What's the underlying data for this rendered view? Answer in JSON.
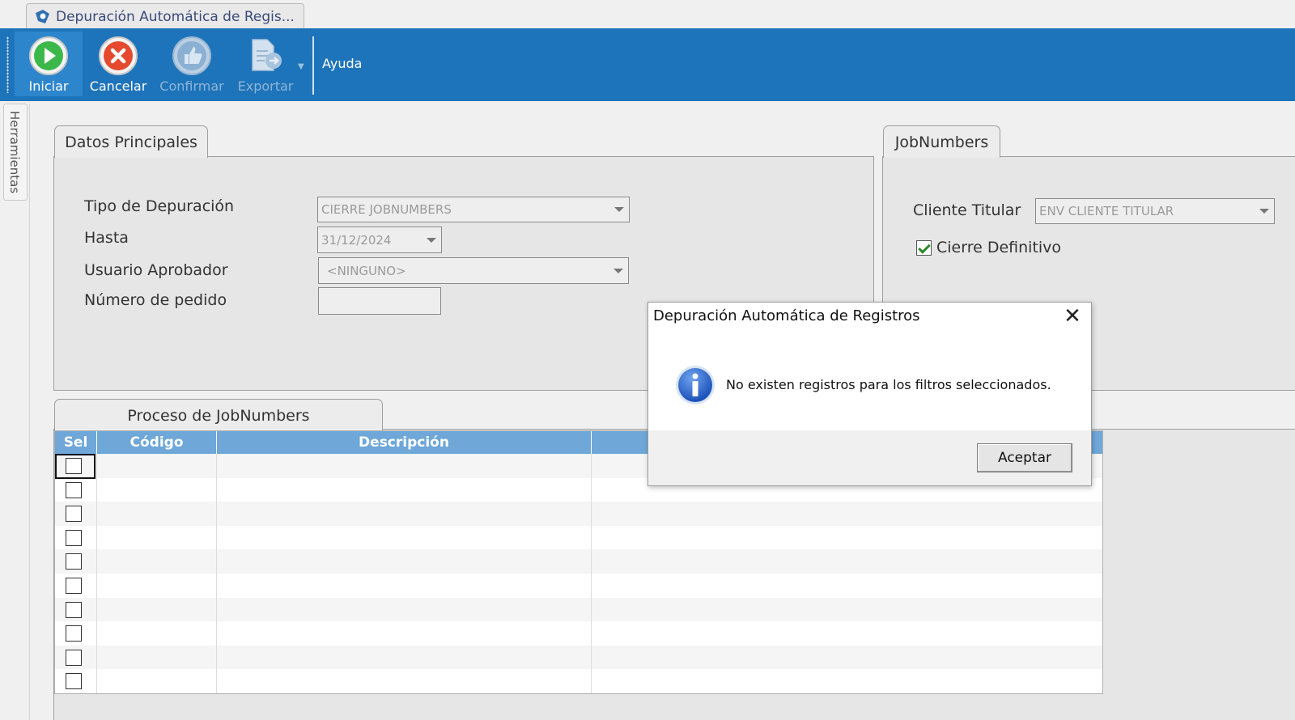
{
  "window": {
    "tab_title": "Depuración Automática de Regis..."
  },
  "toolbar": {
    "buttons": [
      {
        "label": "Iniciar",
        "icon": "play-icon",
        "enabled": true
      },
      {
        "label": "Cancelar",
        "icon": "cancel-icon",
        "enabled": true
      },
      {
        "label": "Confirmar",
        "icon": "thumbs-up-icon",
        "enabled": false
      },
      {
        "label": "Exportar",
        "icon": "export-icon",
        "enabled": false
      }
    ],
    "help_label": "Ayuda"
  },
  "side_panel": {
    "label": "Herramientas"
  },
  "datos_principales": {
    "title": "Datos Principales",
    "tipo_label": "Tipo de Depuración",
    "tipo_value": "CIERRE JOBNUMBERS",
    "hasta_label": "Hasta",
    "hasta_value": "31/12/2024",
    "usuario_label": "Usuario Aprobador",
    "usuario_value": "<NINGUNO>",
    "pedido_label": "Número de pedido",
    "pedido_value": ""
  },
  "jobnumbers": {
    "title": "JobNumbers",
    "cliente_label": "Cliente Titular",
    "cliente_value": "ENV CLIENTE TITULAR",
    "cierre_label": "Cierre Definitivo",
    "cierre_checked": true
  },
  "proceso": {
    "title": "Proceso de JobNumbers",
    "columns": [
      "Sel",
      "Código",
      "Descripción",
      ""
    ],
    "row_count": 10
  },
  "dialog": {
    "title": "Depuración Automática de Registros",
    "message": "No existen registros para los filtros seleccionados.",
    "ok_label": "Aceptar",
    "icon": "info-icon"
  },
  "colors": {
    "toolbar": "#1e74ba",
    "grid_header": "#6ea7d8",
    "panel": "#e6e6e6"
  }
}
